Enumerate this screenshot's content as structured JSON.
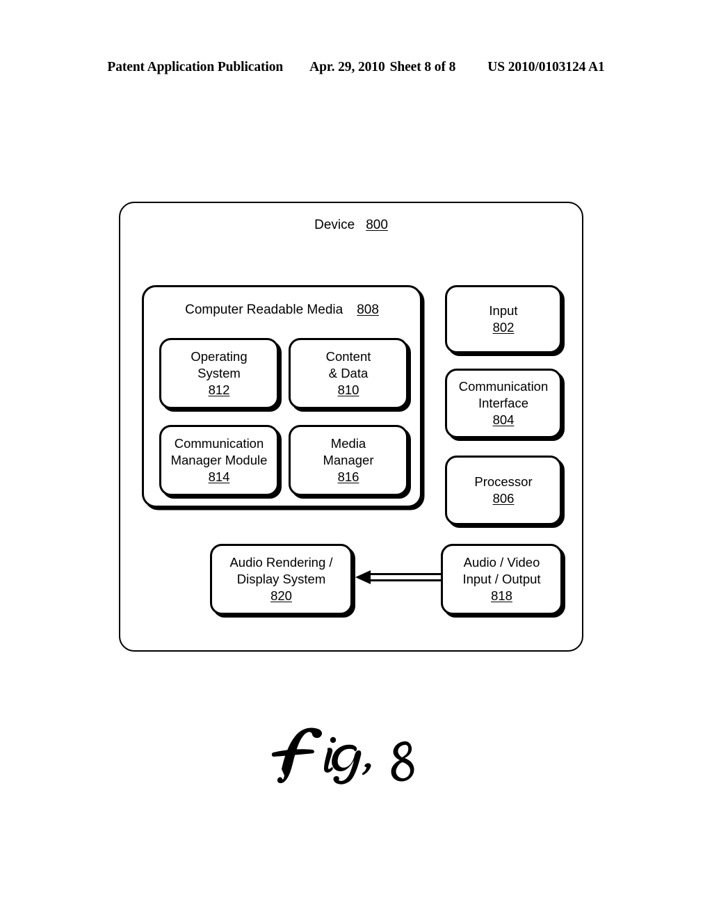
{
  "header": {
    "publication": "Patent Application Publication",
    "date": "Apr. 29, 2010",
    "sheet": "Sheet 8 of 8",
    "patent_number": "US 2010/0103124 A1"
  },
  "figure": {
    "caption": "Fig. 8",
    "device": {
      "label": "Device",
      "ref": "800"
    },
    "computer_readable_media": {
      "label": "Computer Readable Media",
      "ref": "808",
      "modules": [
        {
          "line1": "Operating",
          "line2": "System",
          "ref": "812"
        },
        {
          "line1": "Content",
          "line2": "& Data",
          "ref": "810"
        },
        {
          "line1": "Communication",
          "line2": "Manager Module",
          "ref": "814"
        },
        {
          "line1": "Media",
          "line2": "Manager",
          "ref": "816"
        }
      ]
    },
    "right_column": [
      {
        "line1": "Input",
        "line2": "",
        "ref": "802"
      },
      {
        "line1": "Communication",
        "line2": "Interface",
        "ref": "804"
      },
      {
        "line1": "Processor",
        "line2": "",
        "ref": "806"
      }
    ],
    "bottom_row": [
      {
        "line1": "Audio Rendering /",
        "line2": "Display System",
        "ref": "820"
      },
      {
        "line1": "Audio / Video",
        "line2": "Input / Output",
        "ref": "818"
      }
    ],
    "connection": {
      "name": "double-line-arrow",
      "from_ref": "818",
      "to_ref": "820",
      "direction": "left"
    }
  },
  "colors": {
    "ink": "#000000",
    "paper": "#ffffff"
  }
}
